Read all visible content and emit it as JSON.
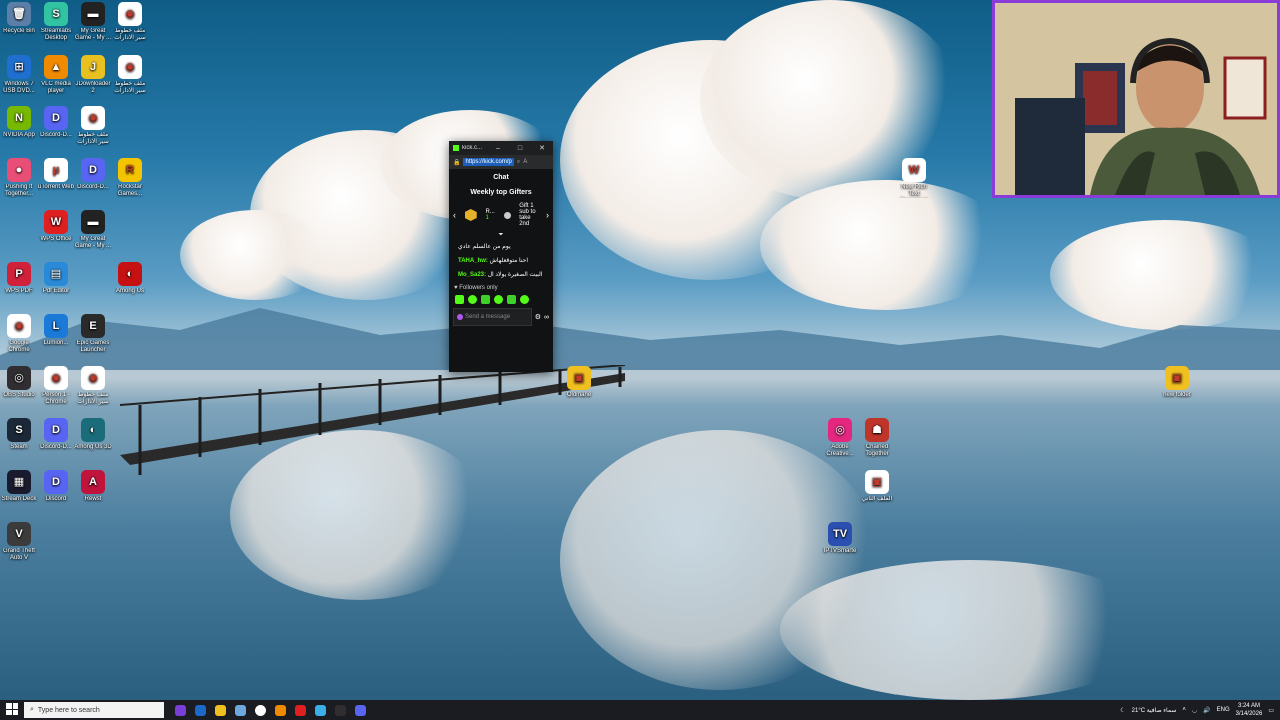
{
  "desktop_icons": [
    {
      "label": "Recycle Bin",
      "color": "#5c7fa8",
      "glyph": "🗑"
    },
    {
      "label": "Streamlabs Desktop",
      "color": "#31c3a2",
      "glyph": "S"
    },
    {
      "label": "My Great Game - My ...",
      "color": "#222",
      "glyph": "▬"
    },
    {
      "label": "ملف خطوط سير الادارات",
      "color": "#ffffff",
      "glyph": "◉"
    },
    {
      "label": "Windows 7 USB DVD...",
      "color": "#1e6fd0",
      "glyph": "⊞"
    },
    {
      "label": "VLC media player",
      "color": "#f08a00",
      "glyph": "▲"
    },
    {
      "label": "JDownloader 2",
      "color": "#e8c020",
      "glyph": "J"
    },
    {
      "label": "ملف خطوط سير الادارات",
      "color": "#ffffff",
      "glyph": "◉"
    },
    {
      "label": "NVIDIA App",
      "color": "#76b900",
      "glyph": "N"
    },
    {
      "label": "Discord-D...",
      "color": "#5865f2",
      "glyph": "D"
    },
    {
      "label": "ملف خطوط سير الادارات",
      "color": "#ffffff",
      "glyph": "◉"
    },
    {
      "label": "Pushing It Together...",
      "color": "#e94e77",
      "glyph": "●"
    },
    {
      "label": "uTorrent Web",
      "color": "#ffffff",
      "glyph": "µ"
    },
    {
      "label": "Discord-D...",
      "color": "#5865f2",
      "glyph": "D"
    },
    {
      "label": "Rockstar Games...",
      "color": "#f5c400",
      "glyph": "R"
    },
    {
      "label": "WPS Office",
      "color": "#e02020",
      "glyph": "W"
    },
    {
      "label": "My Great Game - My ...",
      "color": "#222",
      "glyph": "▬"
    },
    {
      "label": "WPS PDF",
      "color": "#d0203a",
      "glyph": "P"
    },
    {
      "label": "Pdf Editor",
      "color": "#2a8ad8",
      "glyph": "▤"
    },
    {
      "label": "Among Us",
      "color": "#c51111",
      "glyph": "◐"
    },
    {
      "label": "Google Chrome",
      "color": "#ffffff",
      "glyph": "◉"
    },
    {
      "label": "Lumion...",
      "color": "#1b7ad8",
      "glyph": "L"
    },
    {
      "label": "Epic Games Launcher",
      "color": "#2a2a2a",
      "glyph": "E"
    },
    {
      "label": "OBS Studio",
      "color": "#302e31",
      "glyph": "◎"
    },
    {
      "label": "Person 1 - Chrome",
      "color": "#ffffff",
      "glyph": "◉"
    },
    {
      "label": "ملف خطوط سير الادارات",
      "color": "#ffffff",
      "glyph": "◉"
    },
    {
      "label": "Steam",
      "color": "#1b2838",
      "glyph": "S"
    },
    {
      "label": "Discord-D...",
      "color": "#5865f2",
      "glyph": "D"
    },
    {
      "label": "Among Us 3D",
      "color": "#1a6c7a",
      "glyph": "◐"
    },
    {
      "label": "Stream Deck",
      "color": "#1a1a2e",
      "glyph": "▦"
    },
    {
      "label": "Discord",
      "color": "#5865f2",
      "glyph": "D"
    },
    {
      "label": "Rewst",
      "color": "#c0143c",
      "glyph": "A"
    },
    {
      "label": "Grand Theft Auto V",
      "color": "#3b3b3b",
      "glyph": "V"
    },
    {
      "label": "Oldmane",
      "color": "#f0c020",
      "glyph": "▣"
    },
    {
      "label": "New Rich Text Document",
      "color": "#ffffff",
      "glyph": "W"
    },
    {
      "label": "Adobe Creative...",
      "color": "#e4267f",
      "glyph": "◎"
    },
    {
      "label": "Chained Together",
      "color": "#c0352a",
      "glyph": "☗"
    },
    {
      "label": "الملف الثاني",
      "color": "#ffffff",
      "glyph": "▣"
    },
    {
      "label": "IPTVSmarte",
      "color": "#2a4fb0",
      "glyph": "TV"
    },
    {
      "label": "new folder",
      "color": "#f0c020",
      "glyph": "▣"
    }
  ],
  "browser": {
    "tab_title": "kick.c...",
    "url": "https://kick.com/p",
    "minimize": "–",
    "maximize": "□",
    "close": "✕",
    "chat_title": "Chat",
    "gifters_title": "Weekly top Gifters",
    "gifter_name": "R...",
    "gifter_count": "1",
    "gift_hint": "Gift 1 sub to take 2nd",
    "messages": [
      {
        "user": "",
        "text": "يوم من عالسلم عادي"
      },
      {
        "user": "TAHA_hw:",
        "text": "احنا متوقعلهاش"
      },
      {
        "user": "Mo_Sa23:",
        "text": "البيت الصغيرة يولاد ال"
      }
    ],
    "followers_only": "Followers only",
    "send_placeholder": "Send a message"
  },
  "taskbar": {
    "search_placeholder": "Type here to search",
    "apps": [
      "#7a3fd8",
      "#1b6ac9",
      "#f0c020",
      "#6fa8dc",
      "#ffffff",
      "#f08a00",
      "#e02020",
      "#3ab0e8",
      "#302e31",
      "#5865f2"
    ],
    "weather": "21°C سماء صافية",
    "language": "ENG",
    "time": "3:24 AM",
    "date": "3/14/2026"
  },
  "colors": {
    "kick_green": "#53fc18",
    "webcam_border": "#8a3bd8"
  }
}
